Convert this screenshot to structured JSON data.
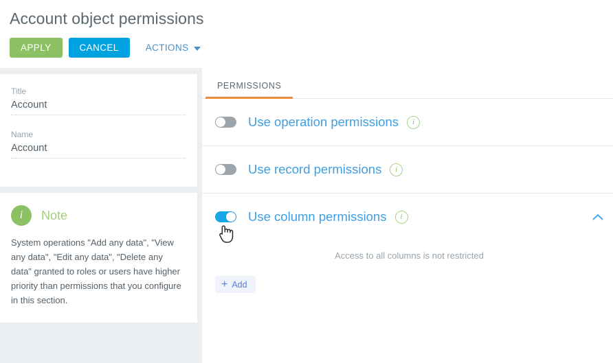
{
  "header": {
    "title": "Account object permissions",
    "apply_label": "APPLY",
    "cancel_label": "CANCEL",
    "actions_label": "ACTIONS"
  },
  "left": {
    "fields": [
      {
        "label": "Title",
        "value": "Account"
      },
      {
        "label": "Name",
        "value": "Account"
      }
    ],
    "note": {
      "icon": "info-icon",
      "title": "Note",
      "text": "System operations \"Add any data\", \"View any data\", \"Edit any data\", \"Delete any data\" granted to roles or users have higher priority than permissions that you configure in this section."
    }
  },
  "right": {
    "tabs": [
      {
        "label": "PERMISSIONS",
        "active": true
      }
    ],
    "permissions": [
      {
        "label": "Use operation permissions",
        "enabled": false,
        "info": "info-icon"
      },
      {
        "label": "Use record permissions",
        "enabled": false,
        "info": "info-icon"
      },
      {
        "label": "Use column permissions",
        "enabled": true,
        "info": "info-icon",
        "chevron": "chevron-up-icon"
      }
    ],
    "column_section": {
      "empty_message": "Access to all columns is not restricted",
      "add_label": "Add",
      "add_plus": "+"
    }
  },
  "colors": {
    "apply_green": "#8cc163",
    "cancel_blue": "#00a1e0",
    "tab_underline_orange": "#ef8a36",
    "toggle_on_blue": "#16a7e8",
    "toggle_off_gray": "#9fa6ab",
    "link_blue": "#3f9fe0",
    "note_green": "#a3cf7e",
    "add_button_blue": "#5b7fd4",
    "page_bg": "#eceff1"
  },
  "cursor": {
    "type": "pointer-hand-cursor"
  }
}
